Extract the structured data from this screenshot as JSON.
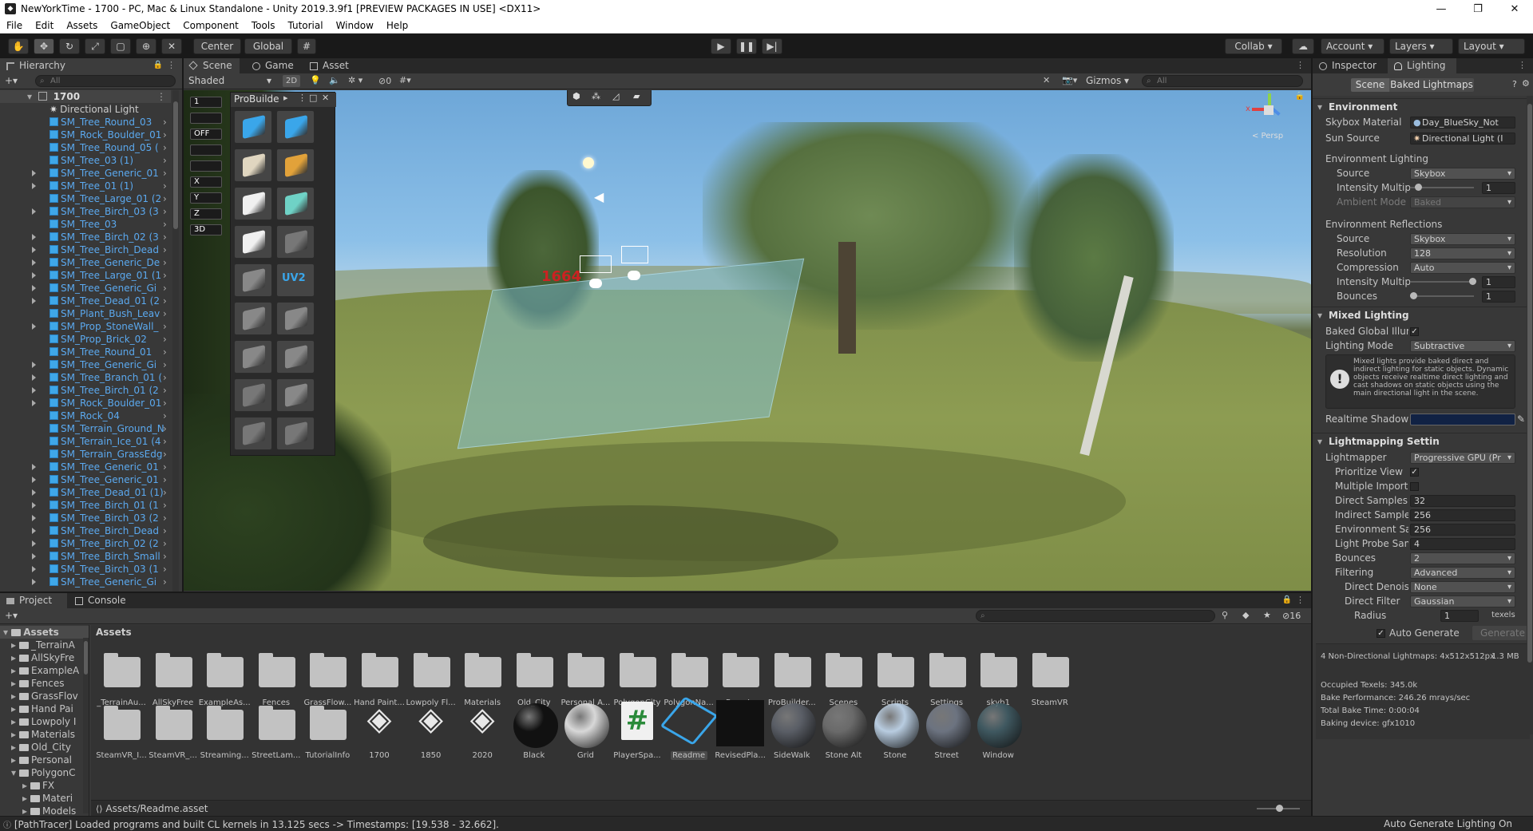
{
  "window": {
    "title": "NewYorkTime - 1700 - PC, Mac & Linux Standalone - Unity 2019.3.9f1 [PREVIEW PACKAGES IN USE] <DX11>",
    "minimize": "—",
    "maximize": "❐",
    "close": "✕"
  },
  "menu": [
    "File",
    "Edit",
    "Assets",
    "GameObject",
    "Component",
    "Tools",
    "Tutorial",
    "Window",
    "Help"
  ],
  "toolbar": {
    "center": "Center",
    "global": "Global",
    "collab": "Collab ▾",
    "account": "Account",
    "layers": "Layers",
    "layout": "Layout"
  },
  "hierarchy": {
    "tab": "Hierarchy",
    "search_placeholder": "All",
    "add": "+▾",
    "root": "1700",
    "items": [
      {
        "name": "Directional Light",
        "light": true,
        "arrow": false
      },
      {
        "name": "SM_Tree_Round_03",
        "arrow": false
      },
      {
        "name": "SM_Rock_Boulder_01",
        "arrow": false
      },
      {
        "name": "SM_Tree_Round_05 (",
        "arrow": false
      },
      {
        "name": "SM_Tree_03 (1)",
        "arrow": false
      },
      {
        "name": "SM_Tree_Generic_01",
        "arrow": true
      },
      {
        "name": "SM_Tree_01 (1)",
        "arrow": true
      },
      {
        "name": "SM_Tree_Large_01 (2",
        "arrow": false
      },
      {
        "name": "SM_Tree_Birch_03 (3",
        "arrow": true
      },
      {
        "name": "SM_Tree_03",
        "arrow": false
      },
      {
        "name": "SM_Tree_Birch_02 (3",
        "arrow": true
      },
      {
        "name": "SM_Tree_Birch_Dead",
        "arrow": true
      },
      {
        "name": "SM_Tree_Generic_De",
        "arrow": true
      },
      {
        "name": "SM_Tree_Large_01 (1",
        "arrow": true
      },
      {
        "name": "SM_Tree_Generic_Gi",
        "arrow": true
      },
      {
        "name": "SM_Tree_Dead_01 (2",
        "arrow": true
      },
      {
        "name": "SM_Plant_Bush_Leav",
        "arrow": false
      },
      {
        "name": "SM_Prop_StoneWall_",
        "arrow": true
      },
      {
        "name": "SM_Prop_Brick_02",
        "arrow": false
      },
      {
        "name": "SM_Tree_Round_01",
        "arrow": false
      },
      {
        "name": "SM_Tree_Generic_Gi",
        "arrow": true
      },
      {
        "name": "SM_Tree_Branch_01 (",
        "arrow": true
      },
      {
        "name": "SM_Tree_Birch_01 (2",
        "arrow": true
      },
      {
        "name": "SM_Rock_Boulder_01",
        "arrow": true
      },
      {
        "name": "SM_Rock_04",
        "arrow": false
      },
      {
        "name": "SM_Terrain_Ground_N",
        "arrow": false
      },
      {
        "name": "SM_Terrain_Ice_01 (4",
        "arrow": false
      },
      {
        "name": "SM_Terrain_GrassEdg",
        "arrow": false
      },
      {
        "name": "SM_Tree_Generic_01",
        "arrow": true
      },
      {
        "name": "SM_Tree_Generic_01",
        "arrow": true
      },
      {
        "name": "SM_Tree_Dead_01 (1)",
        "arrow": true
      },
      {
        "name": "SM_Tree_Birch_01 (1",
        "arrow": true
      },
      {
        "name": "SM_Tree_Birch_03 (2",
        "arrow": true
      },
      {
        "name": "SM_Tree_Birch_Dead",
        "arrow": true
      },
      {
        "name": "SM_Tree_Birch_02 (2",
        "arrow": true
      },
      {
        "name": "SM_Tree_Birch_Small",
        "arrow": true
      },
      {
        "name": "SM_Tree_Birch_03 (1",
        "arrow": true
      },
      {
        "name": "SM_Tree_Generic_Gi",
        "arrow": true
      }
    ]
  },
  "scene": {
    "tabs": [
      "Scene",
      "Game",
      "Asset Store"
    ],
    "shading": "Shaded",
    "mode2d": "2D",
    "hidden_count": "0",
    "gizmos": "Gizmos",
    "search_placeholder": "All",
    "persp": "< Persp",
    "overlay_number": "1664",
    "axis_y": "y",
    "axis_x": "x",
    "probuilder_title": "ProBuilde",
    "probuilder_uv": "UV2",
    "pb_left": [
      "1",
      "",
      "OFF",
      "",
      "",
      "X",
      "Y",
      "Z",
      "3D"
    ]
  },
  "inspector": {
    "tabs": [
      "Inspector",
      "Lighting"
    ],
    "subtabs": [
      "Scene",
      "Baked Lightmaps"
    ],
    "environment": {
      "header": "Environment",
      "skybox_label": "Skybox Material",
      "skybox_value": "Day_BlueSky_Not",
      "sun_label": "Sun Source",
      "sun_value": "Directional Light (I",
      "env_lighting": "Environment Lighting",
      "source_label": "Source",
      "source_value": "Skybox",
      "intensity_label": "Intensity Multipl",
      "intensity_value": "1",
      "ambient_label": "Ambient Mode",
      "ambient_value": "Baked",
      "env_reflections": "Environment Reflections",
      "r_source_label": "Source",
      "r_source_value": "Skybox",
      "resolution_label": "Resolution",
      "resolution_value": "128",
      "compression_label": "Compression",
      "compression_value": "Auto",
      "r_intensity_label": "Intensity Multipl",
      "r_intensity_value": "1",
      "bounces_label": "Bounces",
      "bounces_value": "1"
    },
    "mixed": {
      "header": "Mixed Lighting",
      "baked_gi_label": "Baked Global Illum",
      "mode_label": "Lighting Mode",
      "mode_value": "Subtractive",
      "info": "Mixed lights provide baked direct and indirect lighting for static objects. Dynamic objects receive realtime direct lighting and cast shadows on static objects using the main directional light in the scene.",
      "shadow_label": "Realtime Shadow C"
    },
    "lightmapping": {
      "header": "Lightmapping Settin",
      "rows": [
        {
          "label": "Lightmapper",
          "value": "Progressive GPU (Pr",
          "type": "drop",
          "indent": 0
        },
        {
          "label": "Prioritize View",
          "value": "✓",
          "type": "check",
          "indent": 1
        },
        {
          "label": "Multiple Importa",
          "value": "",
          "type": "check",
          "indent": 1
        },
        {
          "label": "Direct Samples",
          "value": "32",
          "type": "field",
          "indent": 1
        },
        {
          "label": "Indirect Samples",
          "value": "256",
          "type": "field",
          "indent": 1
        },
        {
          "label": "Environment Sa",
          "value": "256",
          "type": "field",
          "indent": 1
        },
        {
          "label": "Light Probe Sam",
          "value": "4",
          "type": "field",
          "indent": 1
        },
        {
          "label": "Bounces",
          "value": "2",
          "type": "drop",
          "indent": 1
        },
        {
          "label": "Filtering",
          "value": "Advanced",
          "type": "drop",
          "indent": 1
        },
        {
          "label": "Direct Denois",
          "value": "None",
          "type": "drop",
          "indent": 2
        },
        {
          "label": "Direct Filter",
          "value": "Gaussian",
          "type": "drop",
          "indent": 2
        },
        {
          "label": "Radius",
          "value": "1",
          "type": "field",
          "indent": 3
        }
      ],
      "radius_unit": "texels"
    },
    "auto_generate": "Auto Generate",
    "generate": "Generate",
    "stats": {
      "lightmaps": "4 Non-Directional Lightmaps: 4x512x512px",
      "size": "1.3 MB",
      "occupied": "Occupied Texels: 345.0k",
      "performance": "Bake Performance: 246.26 mrays/sec",
      "total_time": "Total Bake Time: 0:00:04",
      "device": "Baking device: gfx1010"
    }
  },
  "project": {
    "tabs": [
      "Project",
      "Console"
    ],
    "add": "+▾",
    "hidden_count": "16",
    "breadcrumb": "Assets",
    "tree_root": "Assets",
    "tree": [
      "_TerrainA",
      "AllSkyFre",
      "ExampleA",
      "Fences",
      "GrassFlov",
      "Hand Pai",
      "Lowpoly I",
      "Materials",
      "Old_City",
      "Personal",
      "PolygonC",
      "FX",
      "Materi",
      "Models"
    ],
    "folders": [
      "_TerrainAu...",
      "AllSkyFree",
      "ExampleAs...",
      "Fences",
      "GrassFlow...",
      "Hand Paint...",
      "Lowpoly Fl...",
      "Materials",
      "Old_City",
      "Personal A...",
      "PolygonCity",
      "PolygonNa...",
      "Presets",
      "ProBuilder...",
      "Scenes",
      "Scripts",
      "Settings",
      "skyb1",
      "SteamVR"
    ],
    "row2": [
      {
        "name": "SteamVR_I...",
        "kind": "folder"
      },
      {
        "name": "SteamVR_...",
        "kind": "folder"
      },
      {
        "name": "Streaming...",
        "kind": "folder"
      },
      {
        "name": "StreetLam...",
        "kind": "folder"
      },
      {
        "name": "TutorialInfo",
        "kind": "folder"
      },
      {
        "name": "1700",
        "kind": "unity"
      },
      {
        "name": "1850",
        "kind": "unity"
      },
      {
        "name": "2020",
        "kind": "unity"
      },
      {
        "name": "Black",
        "kind": "ball",
        "color": "#111111"
      },
      {
        "name": "Grid",
        "kind": "ball",
        "color": "#d8d8d8"
      },
      {
        "name": "PlayerSpa...",
        "kind": "script"
      },
      {
        "name": "Readme",
        "kind": "readme"
      },
      {
        "name": "RevisedPla...",
        "kind": "dark"
      },
      {
        "name": "SideWalk",
        "kind": "ball",
        "color": "#5a5e66"
      },
      {
        "name": "Stone Alt",
        "kind": "ball",
        "color": "#6a6a6a"
      },
      {
        "name": "Stone",
        "kind": "ball",
        "color": "#b8cce0"
      },
      {
        "name": "Street",
        "kind": "ball",
        "color": "#6c7380"
      },
      {
        "name": "Window",
        "kind": "ball",
        "color": "#3f5860"
      }
    ],
    "footer_path": "Assets/Readme.asset"
  },
  "status": {
    "message": "[PathTracer] Loaded programs and built CL kernels in 13.125 secs -> Timestamps: [19.538 - 32.662].",
    "right": "Auto Generate Lighting On"
  }
}
